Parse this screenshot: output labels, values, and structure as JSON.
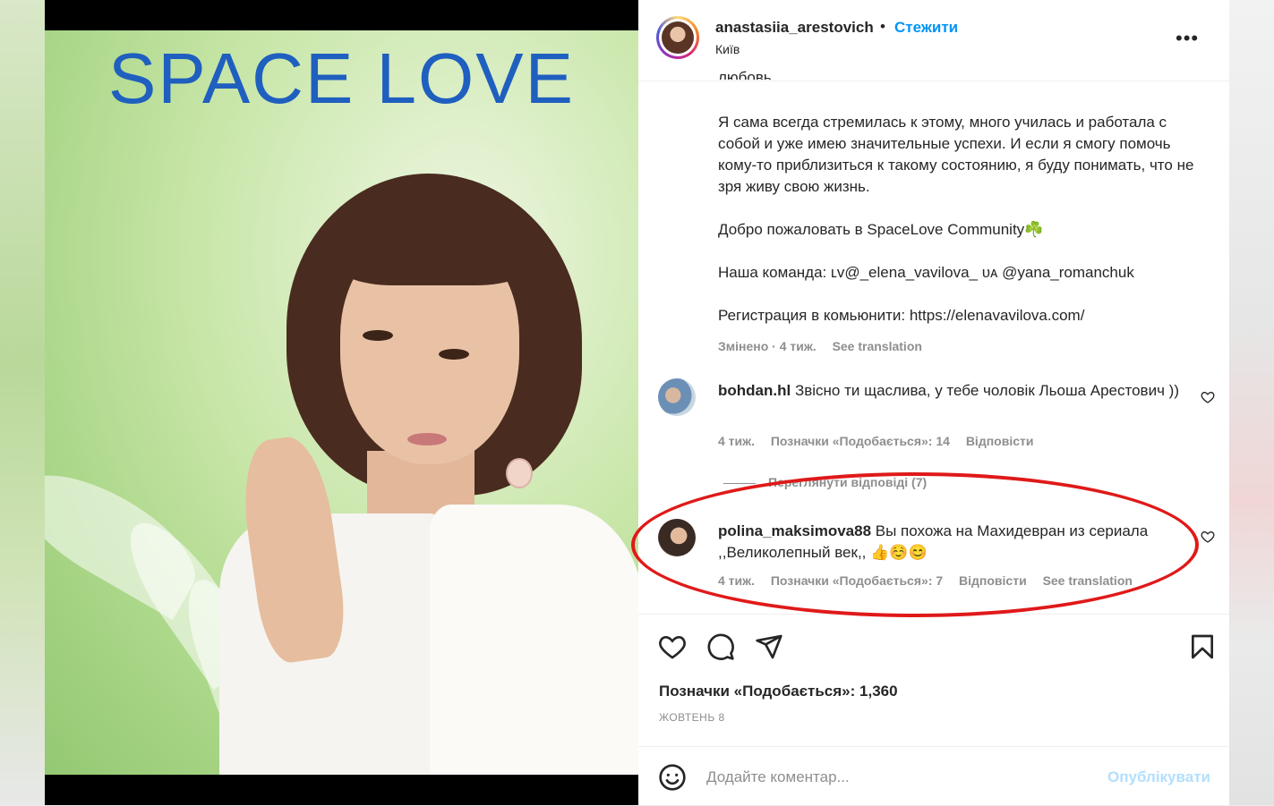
{
  "post_image": {
    "title": "SPACE LOVE"
  },
  "header": {
    "username": "anastasiia_arestovich",
    "separator": "•",
    "follow_label": "Стежити",
    "location": "Київ",
    "more_label": "•••"
  },
  "caption": {
    "cut_line": "любовь.",
    "paragraphs": [
      "Я сама всегда стремилась к этому, много училась и работала с собой и уже имею значительные успехи. И если я смогу помочь кому-то приблизиться к такому состоянию, я буду понимать, что не зря живу свою жизнь.",
      "Добро пожаловать в SpaceLove Community☘️",
      "Наша команда: ʟᴠ@_elena_vavilova_ ᴜᴀ @yana_romanchuk",
      "Регистрация в комьюнити: https://elenavavilova.com/"
    ],
    "edited": "Змінено · 4 тиж.",
    "see_translation": "See translation"
  },
  "comments": [
    {
      "username": "bohdan.hl",
      "text": "Звісно ти щаслива, у тебе чоловік Льоша Арестович ))",
      "time": "4 тиж.",
      "likes": "Позначки «Подобається»: 14",
      "reply": "Відповісти"
    },
    {
      "username": "polina_maksimova88",
      "text": "Вы похожа на Махидевран из сериала ,,Великолепный век,, 👍☺️😊",
      "time": "4 тиж.",
      "likes": "Позначки «Подобається»: 7",
      "reply": "Відповісти",
      "see_translation": "See translation"
    }
  ],
  "view_replies": "Переглянути відповіді (7)",
  "likes_total": "Позначки «Подобається»: 1,360",
  "post_date": "ЖОВТЕНЬ 8",
  "comment_box": {
    "placeholder": "Додайте коментар...",
    "post_label": "Опублікувати"
  },
  "colors": {
    "link": "#0095f6",
    "highlight_oval": "#e01919",
    "poster_title": "#1f5fbf"
  }
}
